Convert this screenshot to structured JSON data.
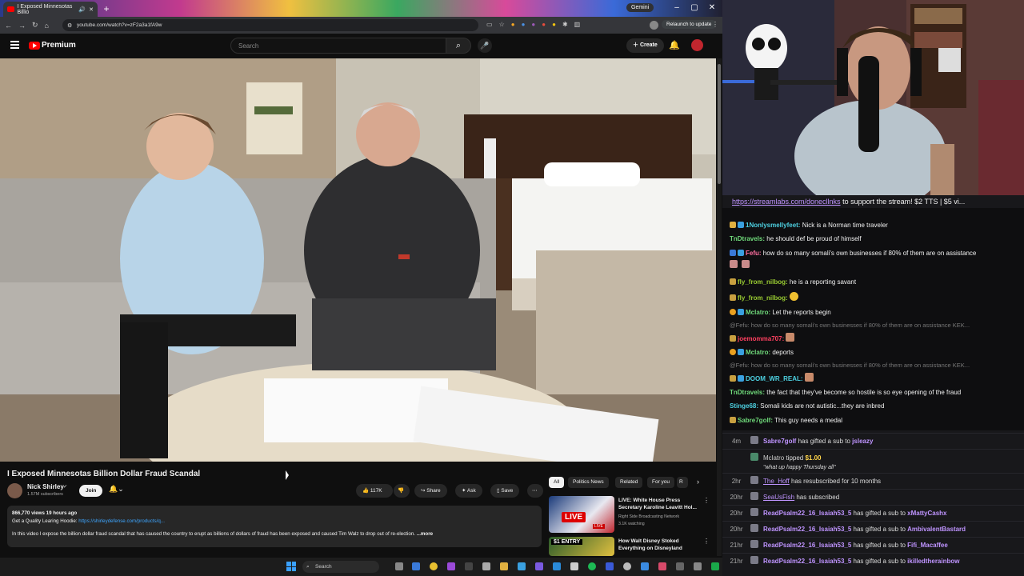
{
  "browser": {
    "tab_title": "I Exposed Minnesotas Billio",
    "gemini_label": "Gemini",
    "url": "youtube.com/watch?v=zF2a3a1fA9w",
    "relaunch_label": "Relaunch to update",
    "new_tab": "+"
  },
  "youtube": {
    "brand": "Premium",
    "search_placeholder": "Search",
    "create_label": "Create",
    "video": {
      "title": "I Exposed Minnesotas Billion Dollar Fraud Scandal",
      "channel": "Nick Shirley",
      "subscribers": "1.57M subscribers",
      "join_label": "Join",
      "likes": "117K",
      "share_label": "Share",
      "ask_label": "Ask",
      "save_label": "Save",
      "views_line": "866,770 views  19 hours ago",
      "desc_line1_prefix": "Get a Quality Learing Hoodie:",
      "desc_line1_link": "https://shirleydefense.com/products/q...",
      "desc_line2": "In this video I expose the billion dollar fraud scandal that has caused the country to erupt as billions of dollars of fraud has been exposed and caused Tim Walz to drop out of re-election.",
      "more_label": "...more"
    },
    "chips": [
      "All",
      "Politics News",
      "Related",
      "For you",
      "R"
    ],
    "recommendations": [
      {
        "title": "LIVE: White House Press Secretary Karoline Leavitt Hol...",
        "channel": "Right Side Broadcasting Network",
        "meta": "3.1K watching",
        "badge": "LIVE",
        "thumb_text": "LIVE"
      },
      {
        "title": "How Walt Disney Stoked Everything on Disneyland",
        "channel": "",
        "meta": "",
        "badge": "",
        "thumb_text": "$1 ENTRY"
      }
    ]
  },
  "taskbar": {
    "search_label": "Search"
  },
  "stream": {
    "banner_link": "https://streamlabs.com/donecllnks",
    "banner_text": " to support the stream! $2 TTS | $5 vi..."
  },
  "chat": [
    {
      "user": "1Nonlysmellyfeet:",
      "color": "#4dd0e1",
      "text": " Nick is a Norman time traveler",
      "reply": ""
    },
    {
      "user": "TnDtravels:",
      "color": "#6fd97a",
      "text": " he should def be proud of himself",
      "reply": ""
    },
    {
      "user": "Fefu:",
      "color": "#ff6fa0",
      "text": " how do so many somali's own businesses if 80% of them are on assistance",
      "reply": ""
    },
    {
      "user": "fly_from_nilbog:",
      "color": "#9acd32",
      "text": " he is a reporting savant",
      "reply": ""
    },
    {
      "user": "fly_from_nilbog:",
      "color": "#9acd32",
      "text": "",
      "reply": ""
    },
    {
      "user": "Mclatro:",
      "color": "#6fd97a",
      "text": " Let the reports begin",
      "reply": ""
    },
    {
      "user": "",
      "color": "#777777",
      "text": "",
      "reply": "@Fefu: how do so many somali's own businesses if 80% of them are on assistance KEK..."
    },
    {
      "user": "joemomma707:",
      "color": "#ff4060",
      "text": "",
      "reply": ""
    },
    {
      "user": "Mclatro:",
      "color": "#6fd97a",
      "text": " deports",
      "reply": ""
    },
    {
      "user": "",
      "color": "#777777",
      "text": "",
      "reply": "@Fefu: how do so many somali's own businesses if 80% of them are on assistance KEK..."
    },
    {
      "user": "DOOM_WR_REAL:",
      "color": "#4dd0e1",
      "text": "",
      "reply": ""
    },
    {
      "user": "TnDtravels:",
      "color": "#6fd97a",
      "text": " the fact that they've become so hostile is so eye opening of the fraud",
      "reply": ""
    },
    {
      "user": "Stinge68:",
      "color": "#4dd0e1",
      "text": " Somali kids are not autistic...they are inbred",
      "reply": ""
    },
    {
      "user": "Sabre7golf:",
      "color": "#6fd97a",
      "text": " This guy needs a medal",
      "reply": ""
    }
  ],
  "events": [
    {
      "time": "4m",
      "name": "Sabre7golf",
      "action": " has gifted a sub to ",
      "target": "jsleazy",
      "note": ""
    },
    {
      "time": "",
      "name": "Mclatro",
      "action": " tipped ",
      "target": "$1.00",
      "note": "\"what up happy Thursday all\""
    },
    {
      "time": "2hr",
      "name": "The_Hoff",
      "action": " has resubscribed for 10 months",
      "target": "",
      "note": ""
    },
    {
      "time": "20hr",
      "name": "SeaUsFish",
      "action": " has subscribed",
      "target": "",
      "note": ""
    },
    {
      "time": "20hr",
      "name": "ReadPsalm22_16_Isaiah53_5",
      "action": " has gifted a sub to ",
      "target": "xMattyCashx",
      "note": ""
    },
    {
      "time": "20hr",
      "name": "ReadPsalm22_16_Isaiah53_5",
      "action": " has gifted a sub to ",
      "target": "AmbivalentBastard",
      "note": ""
    },
    {
      "time": "21hr",
      "name": "ReadPsalm22_16_Isaiah53_5",
      "action": " has gifted a sub to ",
      "target": "Fifi_Macaffee",
      "note": ""
    },
    {
      "time": "21hr",
      "name": "ReadPsalm22_16_Isaiah53_5",
      "action": " has gifted a sub to ",
      "target": "ikilledtherainbow",
      "note": ""
    }
  ]
}
